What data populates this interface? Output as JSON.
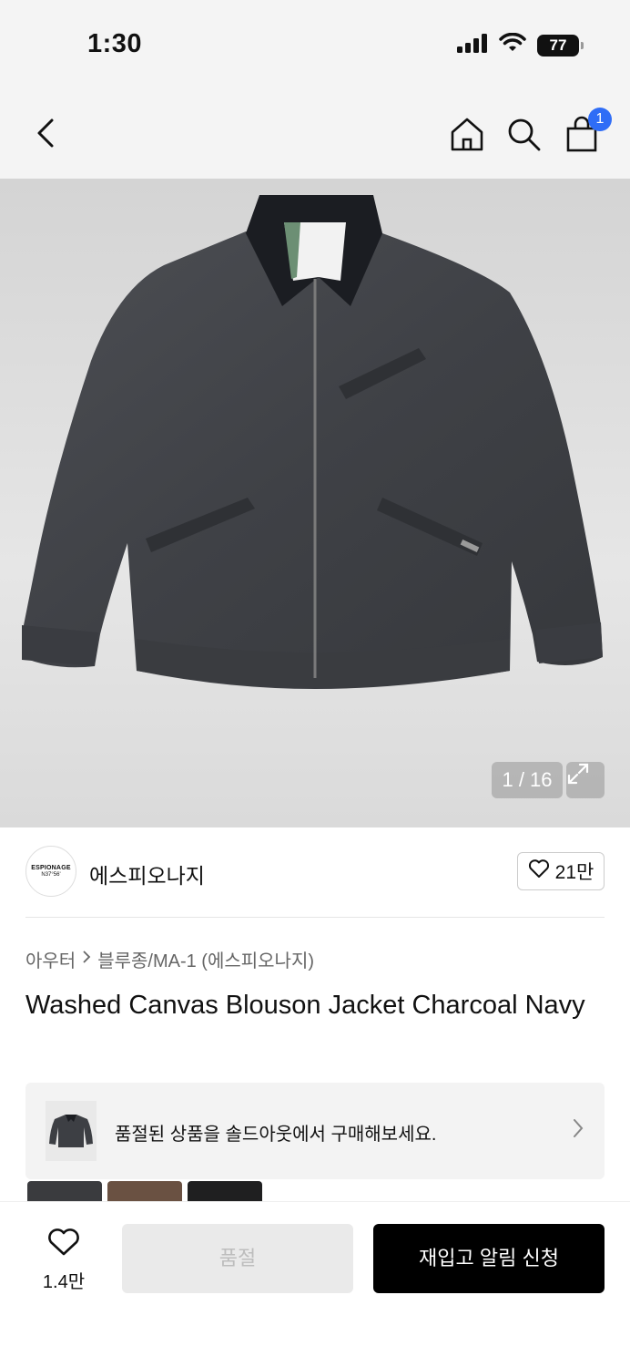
{
  "status_bar": {
    "time": "1:30",
    "battery": "77"
  },
  "nav": {
    "cart_count": "1"
  },
  "gallery": {
    "counter": "1 / 16"
  },
  "brand": {
    "logo_line1": "ESPIONAGE",
    "logo_line2": "N37°56'",
    "name": "에스피오나지",
    "likes": "21만"
  },
  "breadcrumb": {
    "category": "아우터",
    "subcategory": "블루종/MA-1 (에스피오나지)"
  },
  "product": {
    "title": "Washed Canvas Blouson Jacket Charcoal Navy"
  },
  "resale_banner": {
    "text": "품절된 상품을 솔드아웃에서 구매해보세요."
  },
  "colors": {
    "swatches": [
      "#3a3b3e",
      "#6a5142",
      "#1f1f20"
    ]
  },
  "bottom_bar": {
    "wish_count": "1.4만",
    "soldout_label": "품절",
    "restock_label": "재입고 알림 신청"
  },
  "icons": [
    "back-icon",
    "home-icon",
    "search-icon",
    "cart-icon",
    "expand-icon",
    "heart-icon",
    "chevron-right-icon",
    "signal-icon",
    "wifi-icon",
    "battery-icon"
  ]
}
